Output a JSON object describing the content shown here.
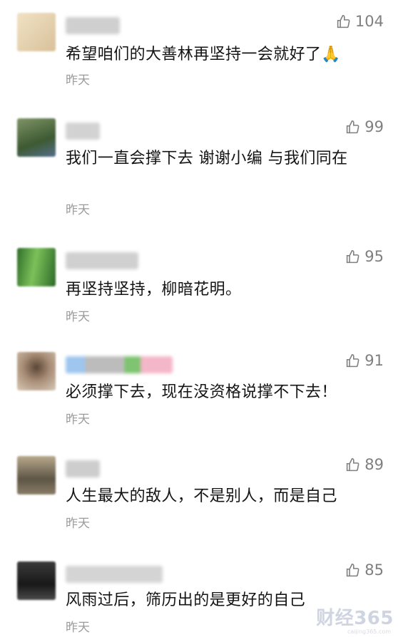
{
  "comments": [
    {
      "likes": "104",
      "text": "希望咱们的大善林再坚持一会就好了",
      "emoji": "🙏",
      "time": "昨天",
      "avatar_color": "#e8d6b4"
    },
    {
      "likes": "99",
      "text": "我们一直会撑下去 谢谢小编 与我们同在",
      "time": "昨天",
      "avatar_color": "#4d6b3d"
    },
    {
      "likes": "95",
      "text": "再坚持坚持，柳暗花明。",
      "time": "昨天",
      "avatar_color": "#3f8a3a"
    },
    {
      "likes": "91",
      "text": "必须撑下去，现在没资格说撑不下去！",
      "time": "昨天",
      "avatar_color": "#a38872"
    },
    {
      "likes": "89",
      "text": "人生最大的敌人，不是别人，而是自己",
      "time": "昨天",
      "avatar_color": "#7a6f5b"
    },
    {
      "likes": "85",
      "text": "风雨过后，筛历出的是更好的自己",
      "time": "昨天",
      "avatar_color": "#2c2c2c"
    }
  ],
  "watermark": {
    "brand": "财经365",
    "url": "caijing365.com"
  }
}
